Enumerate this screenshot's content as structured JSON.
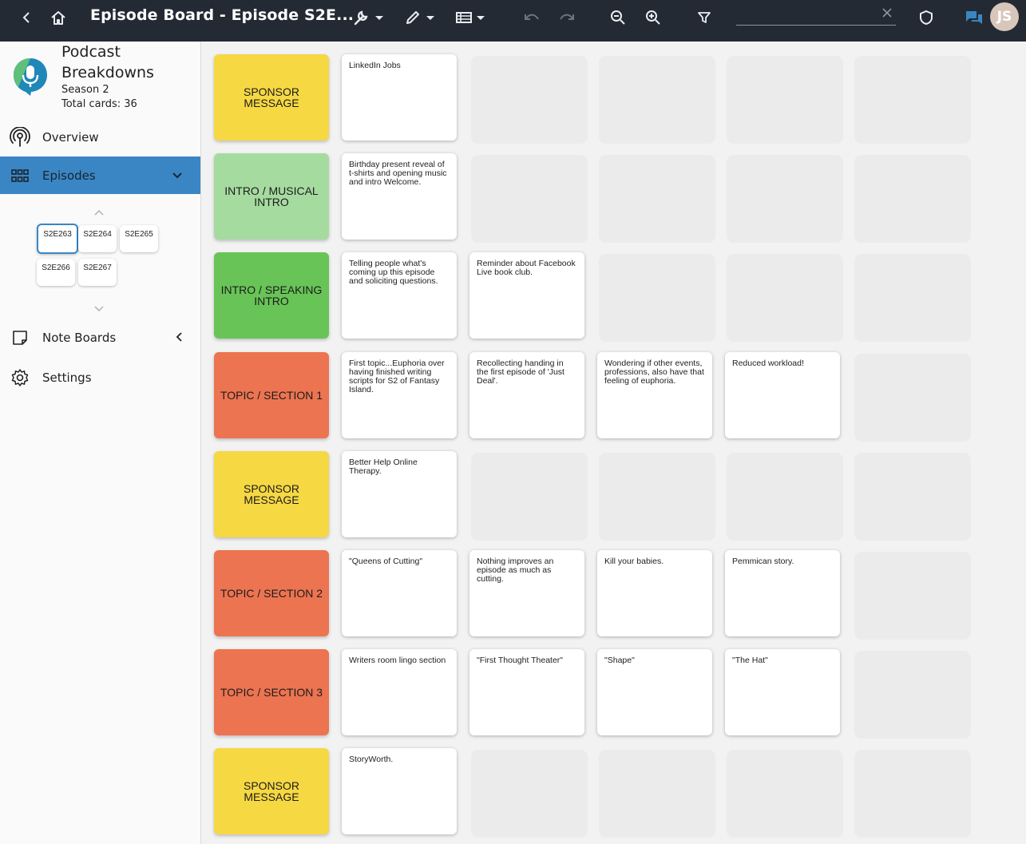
{
  "header": {
    "title": "Episode Board - Episode S2E...",
    "search": {
      "value": "",
      "placeholder": ""
    },
    "avatar_initials": "JS"
  },
  "project": {
    "name": "Podcast Breakdowns",
    "season": "Season 2",
    "total_cards": "Total cards: 36"
  },
  "nav": {
    "overview": "Overview",
    "episodes": "Episodes",
    "note_boards": "Note Boards",
    "settings": "Settings"
  },
  "episodes": [
    "S2E263",
    "S2E264",
    "S2E265",
    "S2E266",
    "S2E267"
  ],
  "selected_episode": "S2E263",
  "colors": {
    "topbar": "#232a33",
    "accent": "#3a86c4",
    "yellow": "#f6d843",
    "light_green": "#a6dba0",
    "green": "#68c457",
    "orange": "#ec7451"
  },
  "rows": [
    {
      "label": "SPONSOR MESSAGE",
      "color": "yellow",
      "cards": [
        "LinkedIn Jobs"
      ]
    },
    {
      "label": "INTRO / MUSICAL INTRO",
      "color": "ltgreen",
      "cards": [
        "Birthday present reveal of t-shirts and opening music and intro Welcome."
      ]
    },
    {
      "label": "INTRO / SPEAKING INTRO",
      "color": "green",
      "cards": [
        "Telling people what's coming up this episode and soliciting questions.",
        "Reminder about Facebook Live book club."
      ]
    },
    {
      "label": "TOPIC / SECTION 1",
      "color": "orange",
      "cards": [
        "First topic...Euphoria over having finished writing scripts for S2 of Fantasy Island.",
        "Recollecting handing in the first episode of 'Just Deal'.",
        "Wondering if other events, professions, also have that feeling of euphoria.",
        "Reduced workload!"
      ]
    },
    {
      "label": "SPONSOR MESSAGE",
      "color": "yellow",
      "cards": [
        "Better Help Online Therapy."
      ]
    },
    {
      "label": "TOPIC / SECTION 2",
      "color": "orange",
      "cards": [
        "\"Queens of Cutting\"",
        "Nothing improves an episode as much as cutting.",
        "Kill your babies.",
        "Pemmican story."
      ]
    },
    {
      "label": "TOPIC / SECTION 3",
      "color": "orange",
      "cards": [
        "Writers room lingo section",
        "\"First Thought Theater\"",
        "\"Shape\"",
        "\"The Hat\""
      ]
    },
    {
      "label": "SPONSOR MESSAGE",
      "color": "yellow",
      "cards": [
        "StoryWorth."
      ]
    }
  ]
}
